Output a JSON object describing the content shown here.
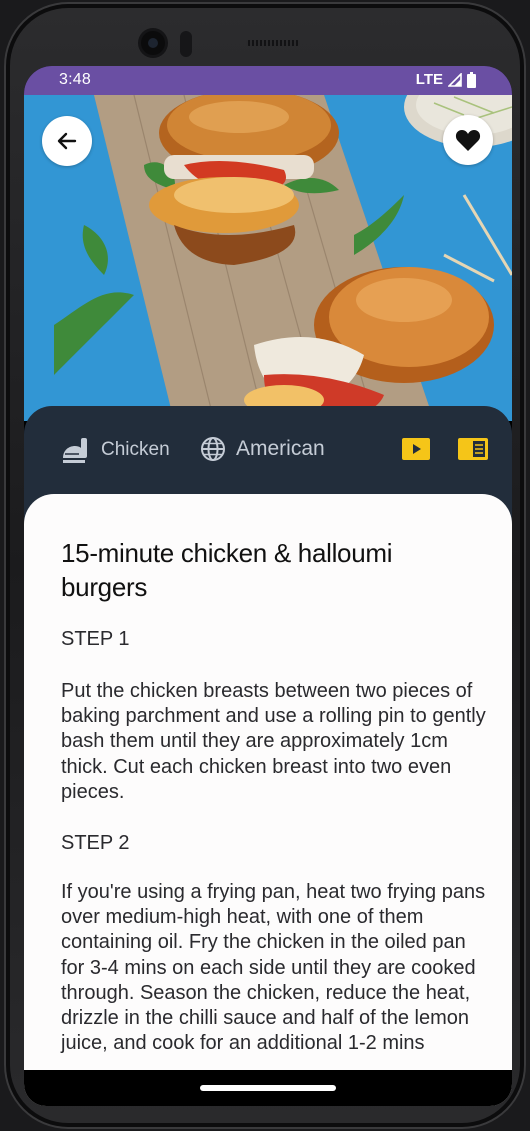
{
  "status_bar": {
    "time": "3:48",
    "network": "LTE"
  },
  "hero": {
    "image_subject": "halloumi chicken burgers on wooden board"
  },
  "header": {
    "back_icon": "arrow-left-icon",
    "favorite_icon": "heart-icon"
  },
  "tags": {
    "category": {
      "icon": "food-icon",
      "label": "Chicken"
    },
    "area": {
      "icon": "globe-icon",
      "label": "American"
    },
    "video_icon": "youtube-icon",
    "article_icon": "article-icon",
    "accent_color": "#f5c518"
  },
  "recipe": {
    "title": "15-minute chicken & halloumi burgers",
    "steps": [
      {
        "heading": "STEP 1",
        "text": "Put the chicken breasts between two pieces of baking parchment and use a rolling pin to gently bash them until they are approximately 1cm thick. Cut each chicken breast into two even pieces."
      },
      {
        "heading": "STEP 2",
        "text": "If you're using a frying pan, heat two frying pans over medium-high heat, with one of them containing oil. Fry the chicken in the oiled pan for 3-4 mins on each side until they are cooked through. Season the chicken, reduce the heat, drizzle in the chilli sauce and half of the lemon juice, and cook for an additional 1-2 mins"
      }
    ]
  },
  "colors": {
    "status_bar": "#6a4fa3",
    "tags_panel": "#222d3b",
    "card": "#fdfcfc"
  }
}
